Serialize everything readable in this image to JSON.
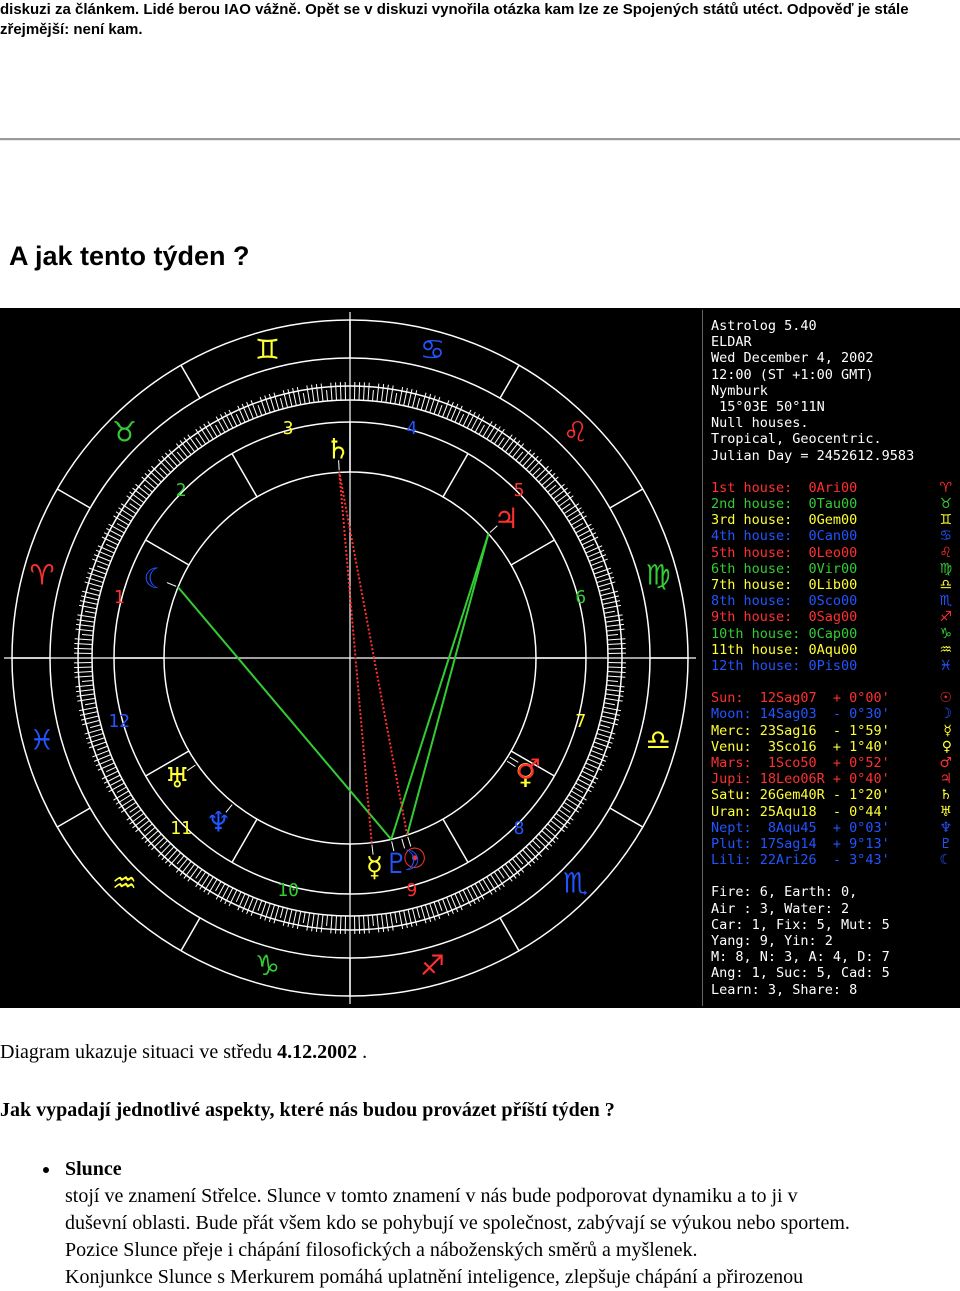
{
  "top_paragraph": "diskuzi za článkem. Lidé berou IAO vážně. Opět se v diskuzi vynořila otázka kam lze ze Spojených států utéct. Odpověď je stále zřejmější: není kam.",
  "heading": "A jak tento týden ?",
  "chart": {
    "header_lines": [
      "Astrolog 5.40",
      "ELDAR",
      "Wed December 4, 2002",
      "12:00 (ST +1:00 GMT)",
      "Nymburk",
      " 15°03E 50°11N",
      "Null houses.",
      "Tropical, Geocentric.",
      "Julian Day = 2452612.9583"
    ],
    "houses": [
      {
        "text": "1st house:  0Ari00",
        "color": "#ff3030",
        "sym": "♈"
      },
      {
        "text": "2nd house:  0Tau00",
        "color": "#33cc33",
        "sym": "♉"
      },
      {
        "text": "3rd house:  0Gem00",
        "color": "#ffff33",
        "sym": "♊"
      },
      {
        "text": "4th house:  0Can00",
        "color": "#2255ff",
        "sym": "♋"
      },
      {
        "text": "5th house:  0Leo00",
        "color": "#ff3030",
        "sym": "♌"
      },
      {
        "text": "6th house:  0Vir00",
        "color": "#33cc33",
        "sym": "♍"
      },
      {
        "text": "7th house:  0Lib00",
        "color": "#ffff33",
        "sym": "♎"
      },
      {
        "text": "8th house:  0Sco00",
        "color": "#2255ff",
        "sym": "♏"
      },
      {
        "text": "9th house:  0Sag00",
        "color": "#ff3030",
        "sym": "♐"
      },
      {
        "text": "10th house: 0Cap00",
        "color": "#33cc33",
        "sym": "♑"
      },
      {
        "text": "11th house: 0Aqu00",
        "color": "#ffff33",
        "sym": "♒"
      },
      {
        "text": "12th house: 0Pis00",
        "color": "#2255ff",
        "sym": "♓"
      }
    ],
    "planets": [
      {
        "text": "Sun:  12Sag07  + 0°00'",
        "color": "#ff3030",
        "sym": "☉"
      },
      {
        "text": "Moon: 14Sag03  - 0°30'",
        "color": "#2255ff",
        "sym": "☽"
      },
      {
        "text": "Merc: 23Sag16  - 1°59'",
        "color": "#ffff33",
        "sym": "☿"
      },
      {
        "text": "Venu:  3Sco16  + 1°40'",
        "color": "#ffff33",
        "sym": "♀"
      },
      {
        "text": "Mars:  1Sco50  + 0°52'",
        "color": "#ff3030",
        "sym": "♂"
      },
      {
        "text": "Jupi: 18Leo06R + 0°40'",
        "color": "#ff3030",
        "sym": "♃"
      },
      {
        "text": "Satu: 26Gem40R - 1°20'",
        "color": "#ffff33",
        "sym": "♄"
      },
      {
        "text": "Uran: 25Aqu18  - 0°44'",
        "color": "#ffff33",
        "sym": "♅"
      },
      {
        "text": "Nept:  8Aqu45  + 0°03'",
        "color": "#2255ff",
        "sym": "♆"
      },
      {
        "text": "Plut: 17Sag14  + 9°13'",
        "color": "#2255ff",
        "sym": "♇"
      },
      {
        "text": "Lili: 22Ari26  - 3°43'",
        "color": "#2255ff",
        "sym": "☾"
      }
    ],
    "stats_lines": [
      "Fire: 6, Earth: 0,",
      "Air : 3, Water: 2",
      "Car: 1, Fix: 5, Mut: 5",
      "Yang: 9, Yin: 2",
      "M: 8, N: 3, A: 4, D: 7",
      "Ang: 1, Suc: 5, Cad: 5",
      "Learn: 3, Share: 8"
    ],
    "house_numbers": [
      "1",
      "2",
      "3",
      "4",
      "5",
      "6",
      "7",
      "8",
      "9",
      "10",
      "11",
      "12"
    ],
    "sign_glyphs": [
      "♈",
      "♉",
      "♊",
      "♋",
      "♌",
      "♍",
      "♎",
      "♏",
      "♐",
      "♑",
      "♒",
      "♓"
    ],
    "sign_colors": [
      "#ff3030",
      "#33cc33",
      "#ffff33",
      "#2255ff"
    ],
    "wheel_planets": [
      {
        "glyph": "☉",
        "color": "#ff3030",
        "lon": 252.1
      },
      {
        "glyph": "☽",
        "color": "#2255ff",
        "lon": 254.0
      },
      {
        "glyph": "☿",
        "color": "#ffff33",
        "lon": 263.3
      },
      {
        "glyph": "♀",
        "color": "#ffff33",
        "lon": 213.3
      },
      {
        "glyph": "♂",
        "color": "#ff3030",
        "lon": 211.8
      },
      {
        "glyph": "♃",
        "color": "#ff3030",
        "lon": 138.1
      },
      {
        "glyph": "♄",
        "color": "#ffff33",
        "lon": 86.7
      },
      {
        "glyph": "♅",
        "color": "#ffff33",
        "lon": 325.3
      },
      {
        "glyph": "♆",
        "color": "#2255ff",
        "lon": 308.8
      },
      {
        "glyph": "♇",
        "color": "#2255ff",
        "lon": 257.2
      },
      {
        "glyph": "☾",
        "color": "#2255ff",
        "lon": 22.4
      }
    ],
    "aspects": [
      {
        "from": 9,
        "to": 10,
        "color": "#33cc33"
      },
      {
        "from": 9,
        "to": 5,
        "color": "#33cc33"
      },
      {
        "from": 0,
        "to": 5,
        "color": "#33cc33"
      },
      {
        "from": 0,
        "to": 6,
        "color": "#ff3030"
      },
      {
        "from": 2,
        "to": 6,
        "color": "#ff3030"
      }
    ]
  },
  "caption_text": "Diagram ukazuje situaci ve středu ",
  "caption_date": "4.12.2002",
  "caption_end": " .",
  "question": "Jak vypadají jednotlivé aspekty, které nás budou provázet příští týden ?",
  "list": {
    "title": "Slunce",
    "lines": [
      "stojí ve znamení Střelce. Slunce v tomto znamení v nás bude podporovat dynamiku a to ji v",
      "duševní oblasti. Bude přát všem kdo se pohybují ve společnost, zabývají se výukou nebo sportem.",
      "Pozice Slunce přeje i chápání filosofických a náboženských směrů a myšlenek.",
      "Konjunkce Slunce s Merkurem pomáhá uplatnění inteligence, zlepšuje chápání a přirozenou"
    ]
  }
}
